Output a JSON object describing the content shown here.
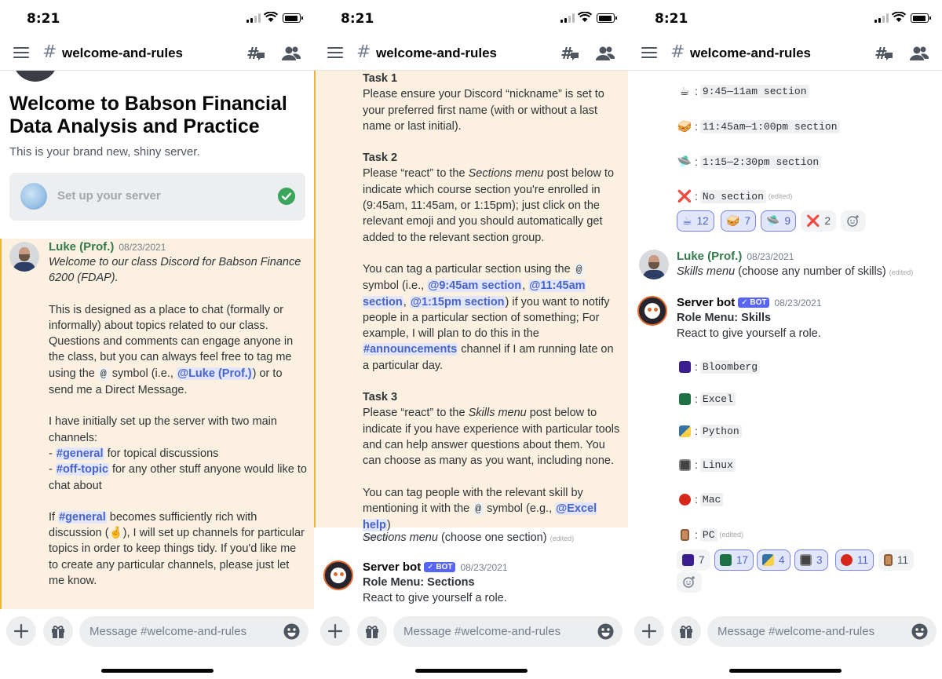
{
  "status": {
    "time": "8:21"
  },
  "channel": {
    "name": "welcome-and-rules",
    "hash": "#"
  },
  "composer": {
    "placeholder": "Message #welcome-and-rules"
  },
  "screen1": {
    "server_title": "Welcome to Babson Financial Data Analysis and Practice",
    "server_subtitle": "This is your brand new, shiny server.",
    "setup_label": "Set up your server",
    "message": {
      "author": "Luke (Prof.)",
      "timestamp": "08/23/2021",
      "intro": "Welcome to our class Discord for Babson Finance 6200 (FDAP).",
      "para2_a": "This is designed as a place to chat (formally or informally) about topics related to our class. Questions and comments can engage anyone in the class, but you can always feel free to tag me using the",
      "at_symbol": "@",
      "para2_b": "symbol (i.e.,",
      "mention_luke": "@Luke (Prof.)",
      "para2_c": ") or to send me a Direct Message.",
      "para3": "I have initially set up the server with two main channels:",
      "dash": "-",
      "ch_general": "#general",
      "ch_general_desc": "for topical discussions",
      "ch_offtopic": "#off-topic",
      "ch_offtopic_desc": "for any other stuff anyone would like to chat about",
      "para4_a": "If",
      "para4_b": "becomes sufficiently rich with discussion (",
      "para4_emoji": "🤞",
      "para4_c": "), I will set up channels for particular topics in order to keep things tidy. If you'd like me to create any particular channels, please just let me know."
    }
  },
  "screen2": {
    "task1_title": "Task 1",
    "task1_body": "Please ensure your Discord “nickname” is set to your preferred first name (with or without a last name or last initial).",
    "task2_title": "Task 2",
    "task2_a": "Please “react” to the",
    "task2_menu": "Sections menu",
    "task2_b": "post below to indicate which course section you're enrolled in (9:45am, 11:45am, or 1:15pm); just click on the relevant emoji and you should automatically get added to the relevant section group.",
    "tag_a": "You can tag a particular section using the",
    "at_symbol": "@",
    "tag_b": "symbol (i.e.,",
    "sec1": "@9:45am section",
    "sec2": "@11:45am section",
    "sec3": "@1:15pm section",
    "tag_c": ") if you want to notify people in a particular section of something; For example, I will plan to do this in the",
    "announcements": "#announcements",
    "tag_d": "channel if I am running late on a particular day.",
    "task3_title": "Task 3",
    "task3_a": "Please “react” to the",
    "task3_menu": "Skills menu",
    "task3_b": "post below to indicate if you have experience with particular tools and can help answer questions about them. You can choose as many as you want, including none.",
    "skill_a": "You can tag people with the relevant skill by mentioning it with the",
    "skill_b": "symbol (e.g.,",
    "excel_help": "@Excel help",
    "skill_c": ")",
    "edited": "(edited)",
    "sections_menu_title": "Sections menu",
    "sections_menu_rest": "(choose one section)",
    "bot": {
      "name": "Server bot",
      "tag": "✓ BOT",
      "timestamp": "08/23/2021",
      "title": "Role Menu: Sections",
      "body": "React to give yourself a role."
    }
  },
  "screen3": {
    "sections": [
      {
        "icon": "coffee-icon",
        "glyph": "☕",
        "label": "9:45—11am section",
        "edited": ""
      },
      {
        "icon": "sandwich-icon",
        "glyph": "🥪",
        "label": "11:45am—1:00pm section",
        "edited": ""
      },
      {
        "icon": "flying-saucer-icon",
        "glyph": "🛸",
        "label": "1:15—2:30pm section",
        "edited": ""
      },
      {
        "icon": "cross-mark-icon",
        "glyph": "❌",
        "label": "No section",
        "edited": "(edited)"
      }
    ],
    "section_reactions": [
      {
        "glyph": "☕",
        "count": "12",
        "active": true
      },
      {
        "glyph": "🥪",
        "count": "7",
        "active": true
      },
      {
        "glyph": "🛸",
        "count": "9",
        "active": true
      },
      {
        "glyph": "❌",
        "count": "2",
        "active": false
      }
    ],
    "luke": {
      "author": "Luke (Prof.)",
      "timestamp": "08/23/2021",
      "menu": "Skills menu",
      "rest": "(choose any number of skills)",
      "edited": "(edited)"
    },
    "bot": {
      "name": "Server bot",
      "tag": "✓ BOT",
      "timestamp": "08/23/2021",
      "title": "Role Menu: Skills",
      "body": "React to give yourself a role."
    },
    "skills": [
      {
        "icon": "bloomberg-icon",
        "label": "Bloomberg",
        "edited": ""
      },
      {
        "icon": "excel-icon",
        "label": "Excel",
        "edited": ""
      },
      {
        "icon": "python-icon",
        "label": "Python",
        "edited": ""
      },
      {
        "icon": "linux-monitor-icon",
        "label": "Linux",
        "edited": ""
      },
      {
        "icon": "apple-icon",
        "label": "Mac",
        "edited": ""
      },
      {
        "icon": "pc-door-icon",
        "label": "PC",
        "edited": "(edited)"
      }
    ],
    "skill_reactions": [
      {
        "icon": "bloomberg-icon",
        "count": "7",
        "active": false
      },
      {
        "icon": "excel-icon",
        "count": "17",
        "active": true
      },
      {
        "icon": "python-icon",
        "count": "4",
        "active": true
      },
      {
        "icon": "linux-monitor-icon",
        "count": "3",
        "active": true
      },
      {
        "icon": "apple-icon",
        "count": "11",
        "active": true
      },
      {
        "icon": "pc-door-icon",
        "count": "11",
        "active": false
      }
    ]
  }
}
